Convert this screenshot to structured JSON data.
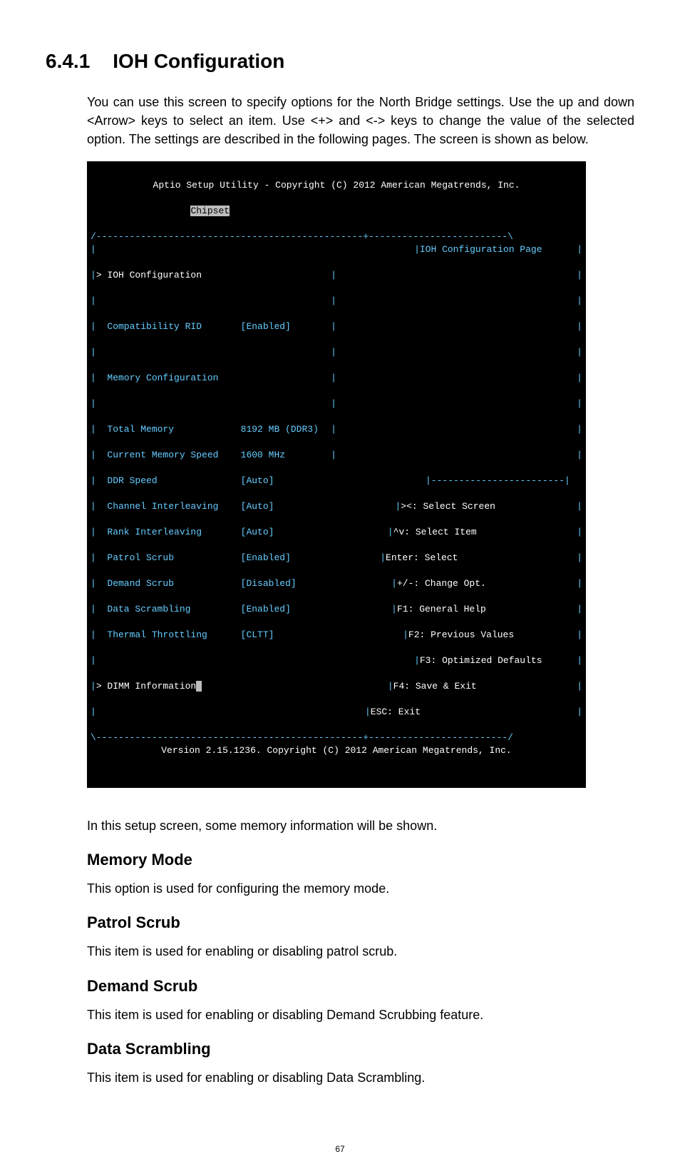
{
  "section": {
    "number": "6.4.1",
    "title": "IOH Configuration"
  },
  "intro": "You can use this screen to specify options for the North Bridge settings. Use the up and down <Arrow> keys to select an item. Use <+> and <-> keys to change the value of the selected option. The settings are described in the following pages. The screen is shown as below.",
  "bios": {
    "header_line": "Aptio Setup Utility - Copyright (C) 2012 American Megatrends, Inc.",
    "tab": "Chipset",
    "help_title": "IOH Configuration Page",
    "menu_ioh": "> IOH Configuration",
    "compat_label": "Compatibility RID",
    "compat_value": "[Enabled]",
    "memcfg_title": "Memory Configuration",
    "total_mem_label": "Total Memory",
    "total_mem_value": "8192 MB (DDR3)",
    "cur_speed_label": "Current Memory Speed",
    "cur_speed_value": "1600 MHz",
    "ddr_label": "DDR Speed",
    "ddr_value": "[Auto]",
    "chan_label": "Channel Interleaving",
    "chan_value": "[Auto]",
    "rank_label": "Rank Interleaving",
    "rank_value": "[Auto]",
    "patrol_label": "Patrol Scrub",
    "patrol_value": "[Enabled]",
    "demand_label": "Demand Scrub",
    "demand_value": "[Disabled]",
    "scram_label": "Data Scrambling",
    "scram_value": "[Enabled]",
    "thermal_label": "Thermal Throttling",
    "thermal_value": "[CLTT]",
    "dimm_info": "> DIMM Information",
    "help": {
      "l1": "><: Select Screen",
      "l2": "^v: Select Item",
      "l3": "Enter: Select",
      "l4": "+/-: Change Opt.",
      "l5": "F1: General Help",
      "l6": "F2: Previous Values",
      "l7": "F3: Optimized Defaults",
      "l8": "F4: Save & Exit",
      "l9": "ESC: Exit"
    },
    "footer": "Version 2.15.1236. Copyright (C) 2012 American Megatrends, Inc."
  },
  "para_after_bios": "In this setup screen, some memory information will be shown.",
  "h_memmode": "Memory Mode",
  "p_memmode": "This option is used for configuring the memory mode.",
  "h_patrol": "Patrol Scrub",
  "p_patrol": "This item is used for enabling or disabling patrol scrub.",
  "h_demand": "Demand Scrub",
  "p_demand": "This item is used for enabling or disabling Demand Scrubbing feature.",
  "h_scram": "Data Scrambling",
  "p_scram": "This item is used for enabling or disabling Data Scrambling.",
  "page_number": "67"
}
